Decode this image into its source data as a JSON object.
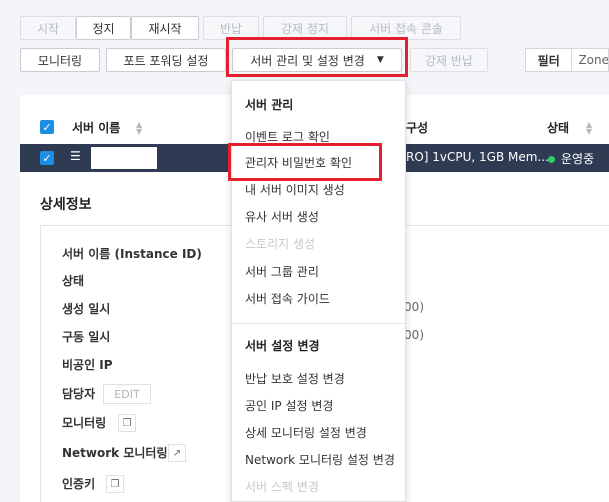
{
  "toolbar": {
    "row1": [
      "시작",
      "정지",
      "재시작",
      "반납",
      "강제 정지",
      "서버 접속 콘솔"
    ],
    "monitoring": "모니터링",
    "port_forwarding": "포트 포워딩 설정",
    "server_manage": "서버 관리 및 설정 변경",
    "force_return": "강제 반납"
  },
  "filter": {
    "label": "필터",
    "value": "Zone"
  },
  "table": {
    "col_name": "서버 이름",
    "col_config_partial": "구성",
    "col_status": "상태",
    "row": {
      "config": "RO] 1vCPU, 1GB Mem...",
      "status": "운영중"
    }
  },
  "details": {
    "title": "상세정보",
    "labels": [
      "서버 이름 (Instance ID)",
      "상태",
      "생성 일시",
      "구동 일시",
      "비공인 IP",
      "담당자",
      "모니터링",
      "Network 모니터링",
      "인증키"
    ],
    "partial_times": [
      ":00)",
      ":00)"
    ],
    "edit": "EDIT"
  },
  "menu": {
    "section1": "서버 관리",
    "items1": [
      "이벤트 로그 확인",
      "관리자 비밀번호 확인",
      "내 서버 이미지 생성",
      "유사 서버 생성",
      "스토리지 생성",
      "서버 그룹 관리",
      "서버 접속 가이드"
    ],
    "section2": "서버 설정 변경",
    "items2": [
      "반납 보호 설정 변경",
      "공인 IP 설정 변경",
      "상세 모니터링 설정 변경",
      "Network 모니터링 설정 변경",
      "서버 스펙 변경"
    ]
  },
  "colors": {
    "highlight": "#e5202e",
    "accent": "#1a8fe3",
    "row_selected": "#2f3b52",
    "status_running": "#2fcf63"
  }
}
